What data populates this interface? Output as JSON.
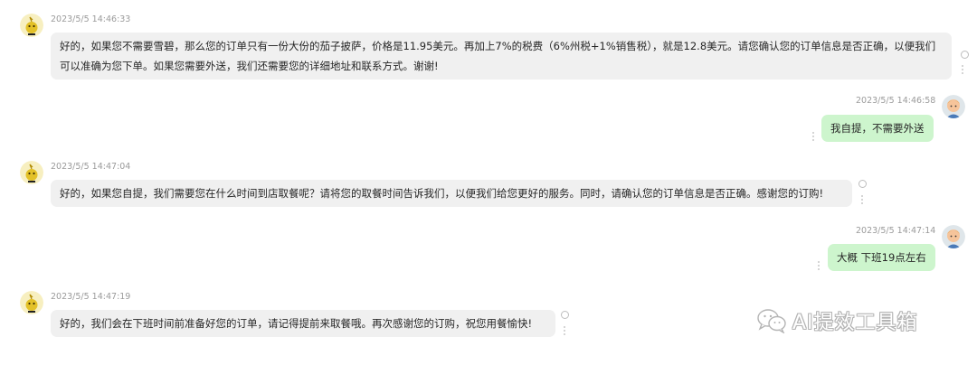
{
  "messages": [
    {
      "sender": "bot",
      "timestamp": "2023/5/5 14:46:33",
      "text": "好的，如果您不需要雪碧，那么您的订单只有一份大份的茄子披萨，价格是11.95美元。再加上7%的税费（6%州税+1%销售税），就是12.8美元。请您确认您的订单信息是否正确，以便我们可以准确为您下单。如果您需要外送，我们还需要您的详细地址和联系方式。谢谢!"
    },
    {
      "sender": "user",
      "timestamp": "2023/5/5 14:46:58",
      "text": "我自提，不需要外送"
    },
    {
      "sender": "bot",
      "timestamp": "2023/5/5 14:47:04",
      "text": "好的，如果您自提，我们需要您在什么时间到店取餐呢？请将您的取餐时间告诉我们，以便我们给您更好的服务。同时，请确认您的订单信息是否正确。感谢您的订购!"
    },
    {
      "sender": "user",
      "timestamp": "2023/5/5 14:47:14",
      "text": "大概 下班19点左右"
    },
    {
      "sender": "bot",
      "timestamp": "2023/5/5 14:47:19",
      "text": "好的，我们会在下班时间前准备好您的订单，请记得提前来取餐哦。再次感谢您的订购，祝您用餐愉快!"
    }
  ],
  "watermark": {
    "text": "AI提效工具箱",
    "icon": "wechat-icon"
  },
  "colors": {
    "bot_bubble": "#f0f0f0",
    "user_bubble": "#cdf5cd",
    "timestamp": "#9b9b9b"
  }
}
